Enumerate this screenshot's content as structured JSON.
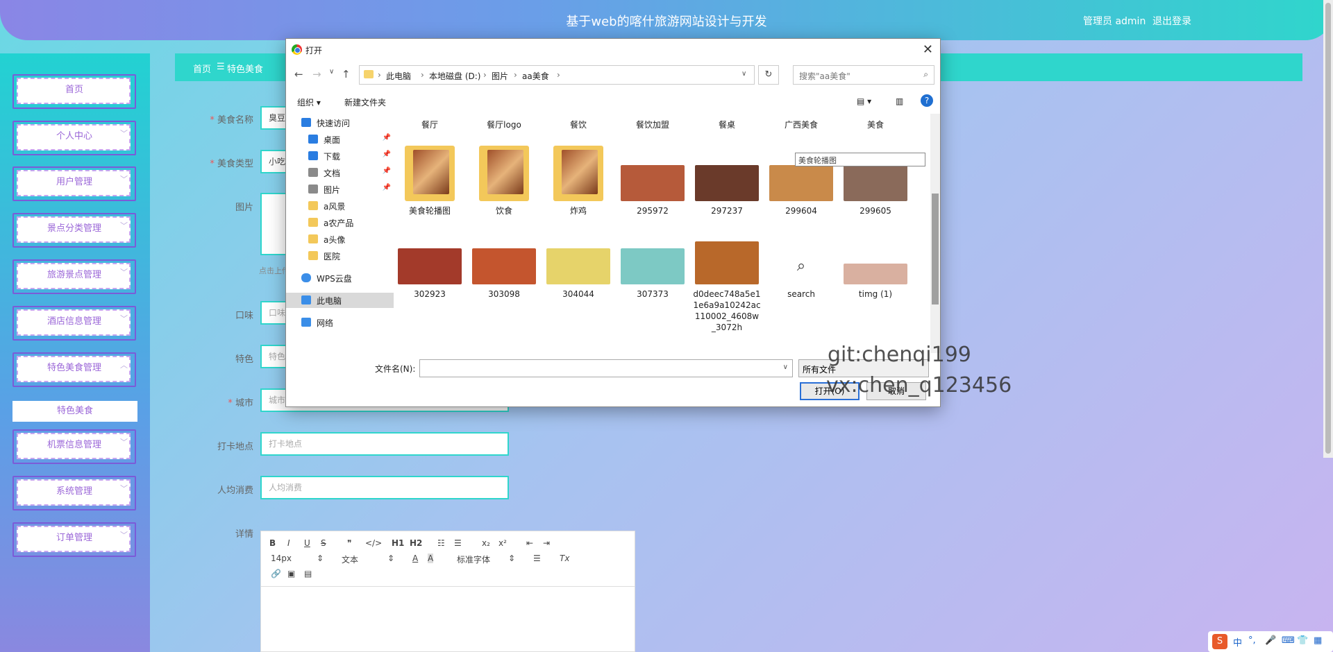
{
  "header": {
    "title": "基于web的喀什旅游网站设计与开发",
    "user": "管理员 admin",
    "logout": "退出登录"
  },
  "sidebar": {
    "items": [
      {
        "label": "首页"
      },
      {
        "label": "个人中心"
      },
      {
        "label": "用户管理"
      },
      {
        "label": "景点分类管理"
      },
      {
        "label": "旅游景点管理"
      },
      {
        "label": "酒店信息管理"
      },
      {
        "label": "特色美食管理"
      },
      {
        "label": "机票信息管理"
      },
      {
        "label": "系统管理"
      },
      {
        "label": "订单管理"
      }
    ],
    "active_sub": "特色美食"
  },
  "breadcrumb": {
    "home": "首页",
    "separator": "☰",
    "current": "特色美食"
  },
  "form": {
    "name_label": "美食名称",
    "name_value": "臭豆",
    "type_label": "美食类型",
    "type_value": "小吃",
    "image_label": "图片",
    "image_hint": "点击上传",
    "taste_label": "口味",
    "taste_placeholder": "口味",
    "feature_label": "特色",
    "feature_placeholder": "特色",
    "city_label": "城市",
    "city_placeholder": "城市",
    "checkin_label": "打卡地点",
    "checkin_placeholder": "打卡地点",
    "cost_label": "人均消费",
    "cost_placeholder": "人均消费",
    "detail_label": "详情",
    "editor": {
      "font_size": "14px",
      "paragraph": "文本",
      "font_family": "标准字体"
    }
  },
  "dialog": {
    "title": "打开",
    "path": [
      "此电脑",
      "本地磁盘 (D:)",
      "图片",
      "aa美食"
    ],
    "search_placeholder": "搜索\"aa美食\"",
    "organize": "组织 ▾",
    "new_folder": "新建文件夹",
    "nav": [
      {
        "label": "快速访问",
        "color": "#2a7de1"
      },
      {
        "label": "桌面",
        "color": "#2a7de1",
        "pin": true
      },
      {
        "label": "下载",
        "color": "#2a7de1",
        "pin": true
      },
      {
        "label": "文档",
        "color": "#8a8a8a",
        "pin": true
      },
      {
        "label": "图片",
        "color": "#8a8a8a",
        "pin": true
      },
      {
        "label": "a风景",
        "color": "#f3c85a"
      },
      {
        "label": "a农产品",
        "color": "#f3c85a"
      },
      {
        "label": "a头像",
        "color": "#f3c85a"
      },
      {
        "label": "医院",
        "color": "#f3c85a"
      },
      {
        "label": "WPS云盘",
        "color": "#3b8ee8"
      },
      {
        "label": "此电脑",
        "color": "#3b8ee8"
      },
      {
        "label": "网络",
        "color": "#3b8ee8"
      }
    ],
    "row1": [
      "餐厅",
      "餐厅logo",
      "餐饮",
      "餐饮加盟",
      "餐桌",
      "广西美食",
      "美食"
    ],
    "folders": [
      "美食轮播图",
      "饮食",
      "炸鸡"
    ],
    "row2": [
      {
        "name": "295972",
        "color": "#b65a3a"
      },
      {
        "name": "297237",
        "color": "#6a3a2a"
      },
      {
        "name": "299604",
        "color": "#c98a4a"
      },
      {
        "name": "299605",
        "color": "#8a6a5a"
      }
    ],
    "row3": [
      {
        "name": "302923",
        "color": "#a33a2a"
      },
      {
        "name": "303098",
        "color": "#c4552e"
      },
      {
        "name": "304044",
        "color": "#e6d36a"
      },
      {
        "name": "307373",
        "color": "#7dc9c4"
      },
      {
        "name": "d0deec748a5e11e6a9a10242ac110002_4608w_3072h",
        "color": "#b8682a"
      },
      {
        "name": "search",
        "color": "#ffffff"
      },
      {
        "name": "timg (1)",
        "color": "#d9b0a0"
      }
    ],
    "tooltip": "美食轮播图",
    "filename_label": "文件名(N):",
    "filetype": "所有文件",
    "open_button": "打开(O)",
    "cancel_button": "取消"
  },
  "watermark": {
    "line1": "git:chenqi199",
    "line2": "vx:chen_q123456"
  },
  "tray": [
    "中",
    "°,",
    "🎤",
    "⌨",
    "👕",
    "▦"
  ]
}
